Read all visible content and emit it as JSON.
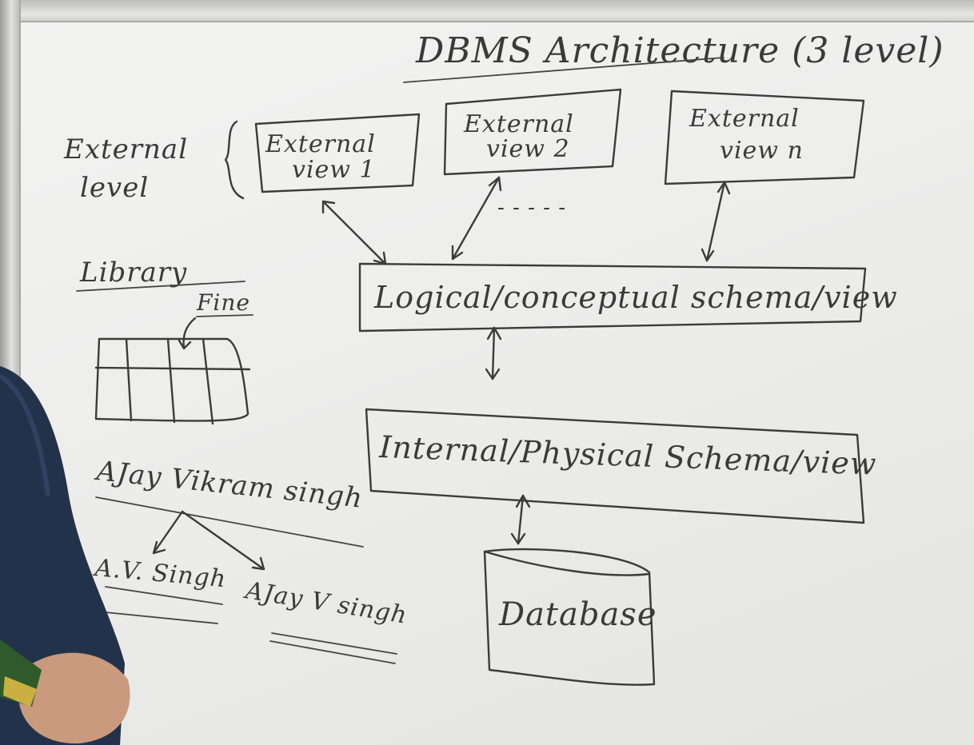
{
  "board": {
    "title": "DBMS Architecture (3 level)",
    "external_level_label": [
      "External",
      "level"
    ],
    "external_views": [
      [
        "External",
        "view 1"
      ],
      [
        "External",
        "view 2"
      ],
      [
        "External",
        "view n"
      ]
    ],
    "ellipsis": "- - - - -",
    "conceptual_box": "Logical/conceptual schema/view",
    "internal_box": "Internal/Physical Schema/view",
    "database_label": "Database",
    "side_notes": {
      "library": "Library",
      "fine": "Fine",
      "full_name": "AJay Vikram singh",
      "short_name_1": "A.V. Singh",
      "short_name_2": "AJay V singh"
    }
  }
}
